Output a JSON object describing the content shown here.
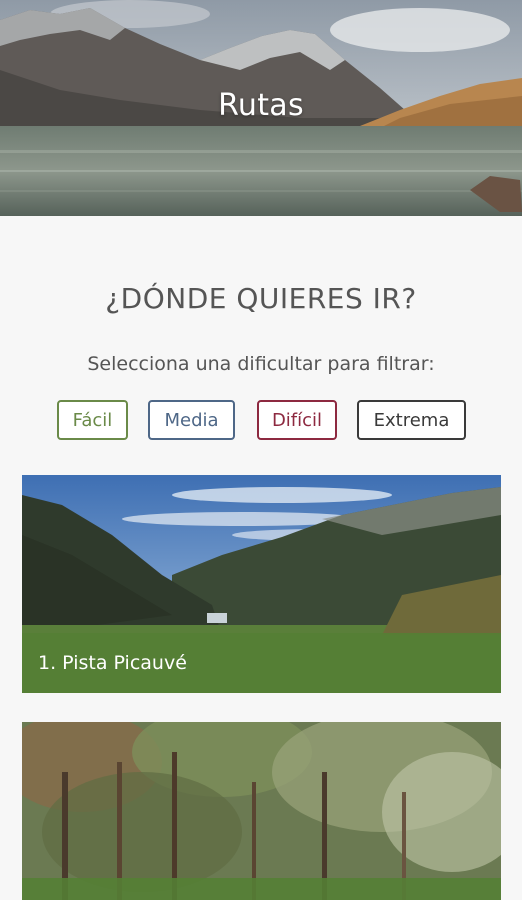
{
  "header": {
    "title": "Rutas"
  },
  "filter": {
    "heading": "¿DÓNDE QUIERES IR?",
    "label": "Selecciona una dificultar para filtrar:",
    "buttons": [
      {
        "label": "Fácil",
        "color": "#6a8a48"
      },
      {
        "label": "Media",
        "color": "#4e6787"
      },
      {
        "label": "Difícil",
        "color": "#8d2940"
      },
      {
        "label": "Extrema",
        "color": "#3a3a3a"
      }
    ]
  },
  "routes": [
    {
      "title": "1. Pista Picauvé",
      "label_color": "#548034"
    },
    {
      "title": "",
      "label_color": "#548034"
    }
  ]
}
